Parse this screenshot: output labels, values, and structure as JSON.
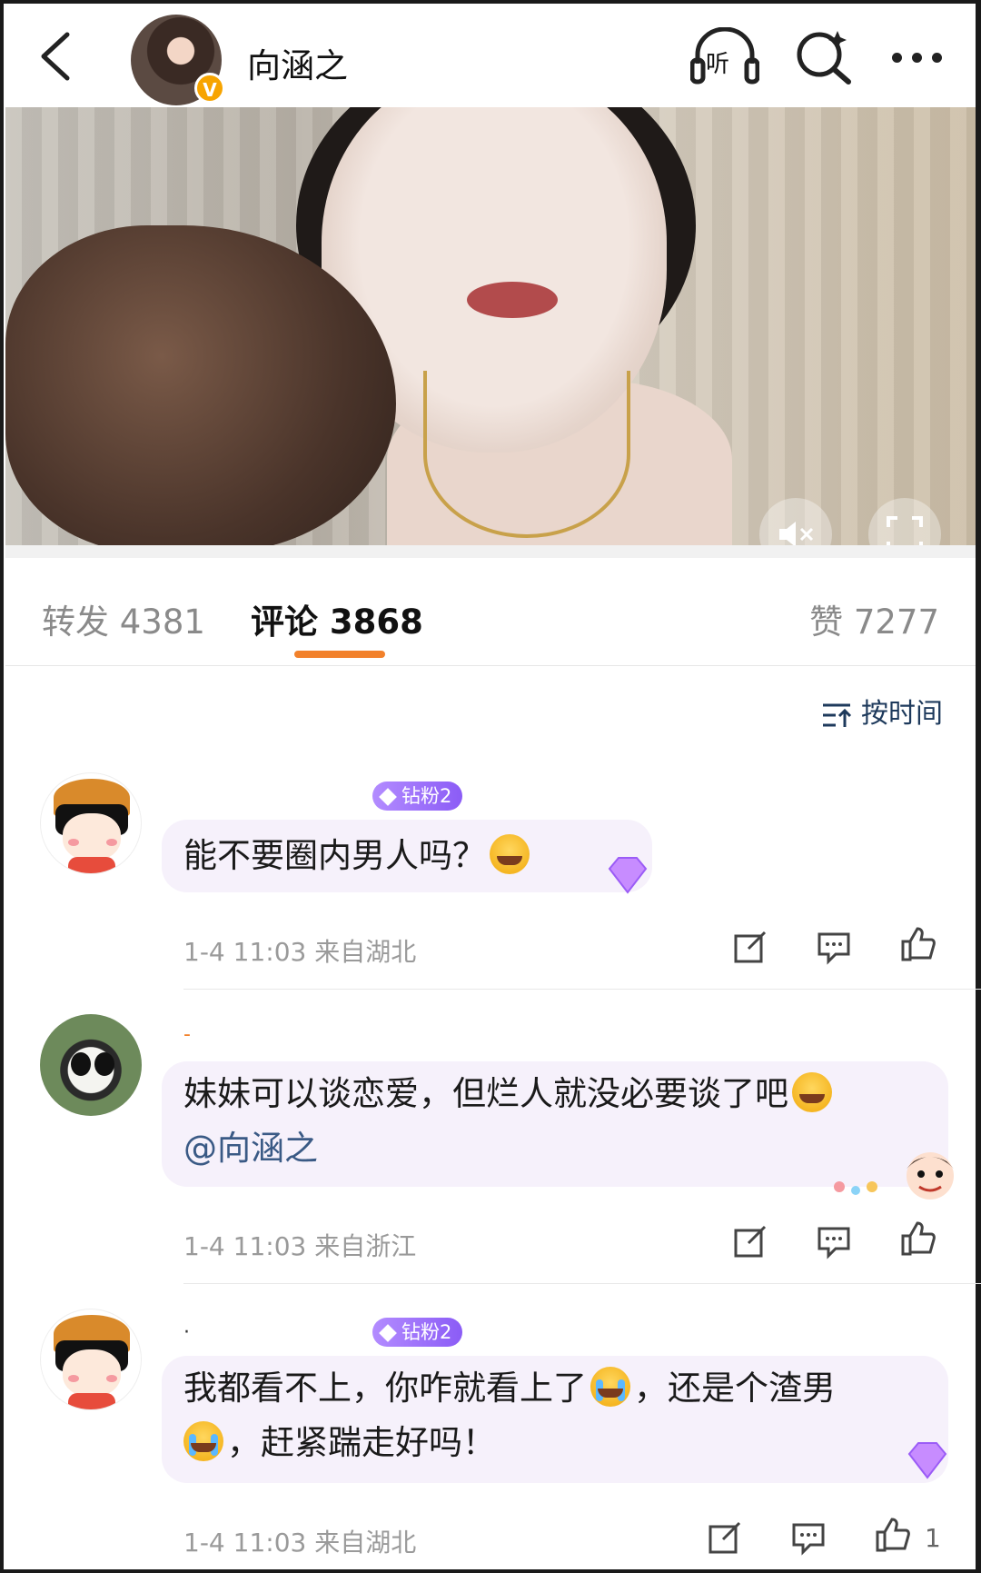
{
  "header": {
    "username": "向涵之",
    "verified_badge": "V",
    "listen_label": "听",
    "icons": [
      "back-icon",
      "headphones-icon",
      "ai-search-icon",
      "more-icon"
    ]
  },
  "tabs": {
    "repost": "转发 4381",
    "comment": "评论 3868",
    "like": "赞 7277",
    "active": "comment",
    "accent": "#f2812b"
  },
  "sort_label": "按时间",
  "comments": [
    {
      "badge": "钻粉2",
      "text": "能不要圈内男人吗？",
      "meta": "1-4 11:03  来自湖北"
    },
    {
      "name_mark": "-",
      "text": "妹妹可以谈恋爱，但烂人就没必要谈了吧",
      "mention": "@向涵之",
      "meta": "1-4 11:03  来自浙江"
    },
    {
      "name_mark": "·",
      "badge": "钻粉2",
      "text_line1": "我都看不上，你咋就看上了",
      "text_line1b": "，还是个渣男",
      "text_line2": "，赶紧踹走好吗！",
      "meta": "1-4 11:03  来自湖北",
      "likes": "1"
    }
  ]
}
